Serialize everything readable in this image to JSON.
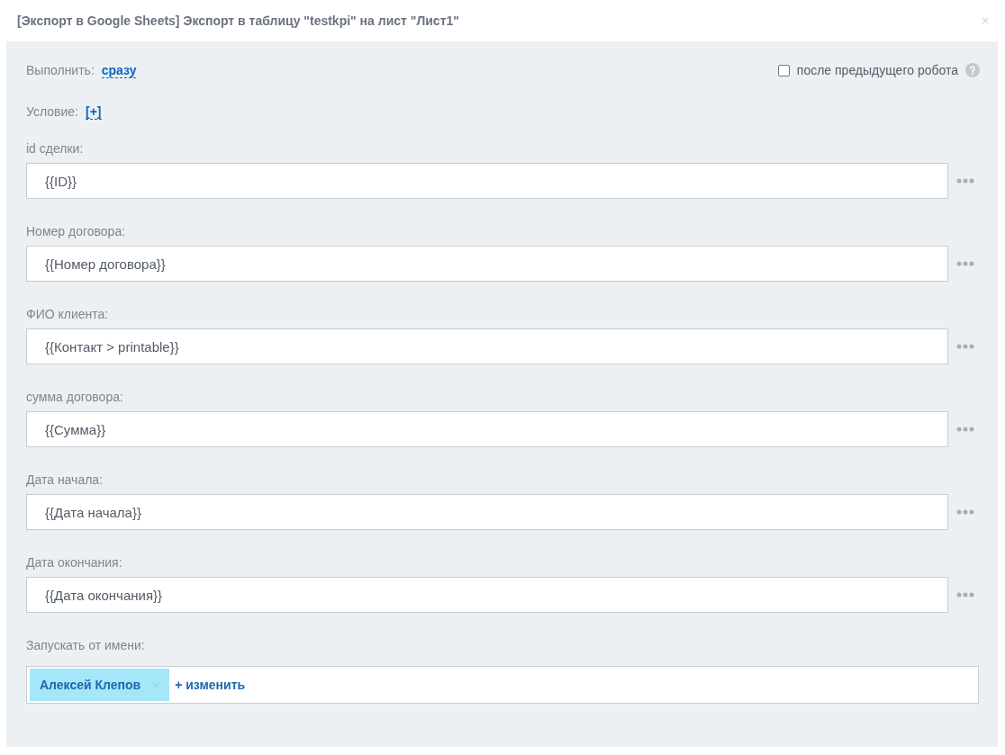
{
  "window": {
    "title": "[Экспорт в Google Sheets] Экспорт в таблицу \"testkpi\" на лист \"Лист1\""
  },
  "execute": {
    "label": "Выполнить:",
    "value": "сразу"
  },
  "after_previous": {
    "label": "после предыдущего робота",
    "checked": false
  },
  "condition": {
    "label": "Условие:",
    "value": "[+]"
  },
  "fields": [
    {
      "label": "id сделки:",
      "value": "{{ID}}"
    },
    {
      "label": "Номер договора:",
      "value": "{{Номер договора}}"
    },
    {
      "label": "ФИО клиента:",
      "value": "{{Контакт > printable}}"
    },
    {
      "label": "сумма договора:",
      "value": "{{Сумма}}"
    },
    {
      "label": "Дата начала:",
      "value": "{{Дата начала}}"
    },
    {
      "label": "Дата окончания:",
      "value": "{{Дата окончания}}"
    }
  ],
  "run_as": {
    "label": "Запускать от имени:",
    "users": [
      "Алексей Клепов"
    ],
    "change_link": "+ изменить"
  }
}
